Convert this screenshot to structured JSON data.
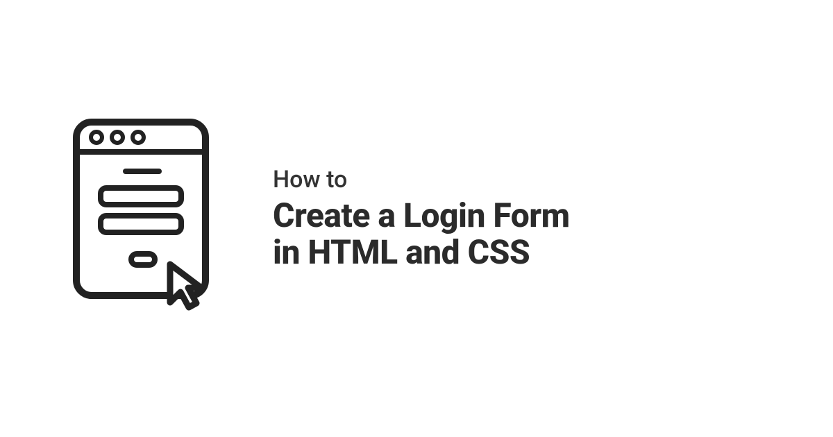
{
  "text": {
    "prefix": "How to",
    "headline_line1": "Create a Login Form",
    "headline_line2": "in HTML and CSS"
  },
  "colors": {
    "foreground": "#2b2b2b",
    "background": "#ffffff"
  }
}
